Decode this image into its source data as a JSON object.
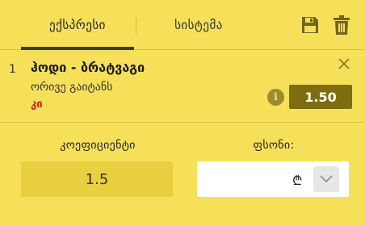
{
  "tabs": {
    "express_label": "ექსპრესი",
    "system_label": "სისტემა"
  },
  "bet": {
    "index": "1",
    "title": "ჰოდი - ბრატვაგი",
    "market": "ორივე გაიტანს",
    "outcome": "კი",
    "odds": "1.50"
  },
  "bottom": {
    "coef_label": "კოეფიციენტი",
    "coef_value": "1.5",
    "stake_label": "ფსონი:",
    "stake_value": "",
    "currency_symbol": "₾"
  },
  "icons": {
    "save": "save-icon",
    "trash": "trash-icon",
    "close": "close-icon",
    "info": "info-icon",
    "chevron": "chevron-down-icon"
  },
  "colors": {
    "background": "#f6e05a",
    "odds_badge": "#7d6d0f",
    "outcome_red": "#c62121",
    "tab_underline": "#3b3b3b"
  }
}
